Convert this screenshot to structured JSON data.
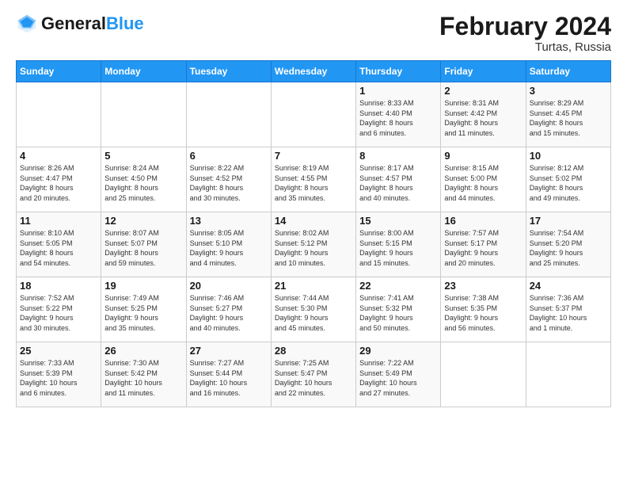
{
  "header": {
    "logo_general": "General",
    "logo_blue": "Blue",
    "month_year": "February 2024",
    "location": "Turtas, Russia"
  },
  "days_of_week": [
    "Sunday",
    "Monday",
    "Tuesday",
    "Wednesday",
    "Thursday",
    "Friday",
    "Saturday"
  ],
  "weeks": [
    [
      {
        "day": "",
        "info": ""
      },
      {
        "day": "",
        "info": ""
      },
      {
        "day": "",
        "info": ""
      },
      {
        "day": "",
        "info": ""
      },
      {
        "day": "1",
        "info": "Sunrise: 8:33 AM\nSunset: 4:40 PM\nDaylight: 8 hours\nand 6 minutes."
      },
      {
        "day": "2",
        "info": "Sunrise: 8:31 AM\nSunset: 4:42 PM\nDaylight: 8 hours\nand 11 minutes."
      },
      {
        "day": "3",
        "info": "Sunrise: 8:29 AM\nSunset: 4:45 PM\nDaylight: 8 hours\nand 15 minutes."
      }
    ],
    [
      {
        "day": "4",
        "info": "Sunrise: 8:26 AM\nSunset: 4:47 PM\nDaylight: 8 hours\nand 20 minutes."
      },
      {
        "day": "5",
        "info": "Sunrise: 8:24 AM\nSunset: 4:50 PM\nDaylight: 8 hours\nand 25 minutes."
      },
      {
        "day": "6",
        "info": "Sunrise: 8:22 AM\nSunset: 4:52 PM\nDaylight: 8 hours\nand 30 minutes."
      },
      {
        "day": "7",
        "info": "Sunrise: 8:19 AM\nSunset: 4:55 PM\nDaylight: 8 hours\nand 35 minutes."
      },
      {
        "day": "8",
        "info": "Sunrise: 8:17 AM\nSunset: 4:57 PM\nDaylight: 8 hours\nand 40 minutes."
      },
      {
        "day": "9",
        "info": "Sunrise: 8:15 AM\nSunset: 5:00 PM\nDaylight: 8 hours\nand 44 minutes."
      },
      {
        "day": "10",
        "info": "Sunrise: 8:12 AM\nSunset: 5:02 PM\nDaylight: 8 hours\nand 49 minutes."
      }
    ],
    [
      {
        "day": "11",
        "info": "Sunrise: 8:10 AM\nSunset: 5:05 PM\nDaylight: 8 hours\nand 54 minutes."
      },
      {
        "day": "12",
        "info": "Sunrise: 8:07 AM\nSunset: 5:07 PM\nDaylight: 8 hours\nand 59 minutes."
      },
      {
        "day": "13",
        "info": "Sunrise: 8:05 AM\nSunset: 5:10 PM\nDaylight: 9 hours\nand 4 minutes."
      },
      {
        "day": "14",
        "info": "Sunrise: 8:02 AM\nSunset: 5:12 PM\nDaylight: 9 hours\nand 10 minutes."
      },
      {
        "day": "15",
        "info": "Sunrise: 8:00 AM\nSunset: 5:15 PM\nDaylight: 9 hours\nand 15 minutes."
      },
      {
        "day": "16",
        "info": "Sunrise: 7:57 AM\nSunset: 5:17 PM\nDaylight: 9 hours\nand 20 minutes."
      },
      {
        "day": "17",
        "info": "Sunrise: 7:54 AM\nSunset: 5:20 PM\nDaylight: 9 hours\nand 25 minutes."
      }
    ],
    [
      {
        "day": "18",
        "info": "Sunrise: 7:52 AM\nSunset: 5:22 PM\nDaylight: 9 hours\nand 30 minutes."
      },
      {
        "day": "19",
        "info": "Sunrise: 7:49 AM\nSunset: 5:25 PM\nDaylight: 9 hours\nand 35 minutes."
      },
      {
        "day": "20",
        "info": "Sunrise: 7:46 AM\nSunset: 5:27 PM\nDaylight: 9 hours\nand 40 minutes."
      },
      {
        "day": "21",
        "info": "Sunrise: 7:44 AM\nSunset: 5:30 PM\nDaylight: 9 hours\nand 45 minutes."
      },
      {
        "day": "22",
        "info": "Sunrise: 7:41 AM\nSunset: 5:32 PM\nDaylight: 9 hours\nand 50 minutes."
      },
      {
        "day": "23",
        "info": "Sunrise: 7:38 AM\nSunset: 5:35 PM\nDaylight: 9 hours\nand 56 minutes."
      },
      {
        "day": "24",
        "info": "Sunrise: 7:36 AM\nSunset: 5:37 PM\nDaylight: 10 hours\nand 1 minute."
      }
    ],
    [
      {
        "day": "25",
        "info": "Sunrise: 7:33 AM\nSunset: 5:39 PM\nDaylight: 10 hours\nand 6 minutes."
      },
      {
        "day": "26",
        "info": "Sunrise: 7:30 AM\nSunset: 5:42 PM\nDaylight: 10 hours\nand 11 minutes."
      },
      {
        "day": "27",
        "info": "Sunrise: 7:27 AM\nSunset: 5:44 PM\nDaylight: 10 hours\nand 16 minutes."
      },
      {
        "day": "28",
        "info": "Sunrise: 7:25 AM\nSunset: 5:47 PM\nDaylight: 10 hours\nand 22 minutes."
      },
      {
        "day": "29",
        "info": "Sunrise: 7:22 AM\nSunset: 5:49 PM\nDaylight: 10 hours\nand 27 minutes."
      },
      {
        "day": "",
        "info": ""
      },
      {
        "day": "",
        "info": ""
      }
    ]
  ]
}
